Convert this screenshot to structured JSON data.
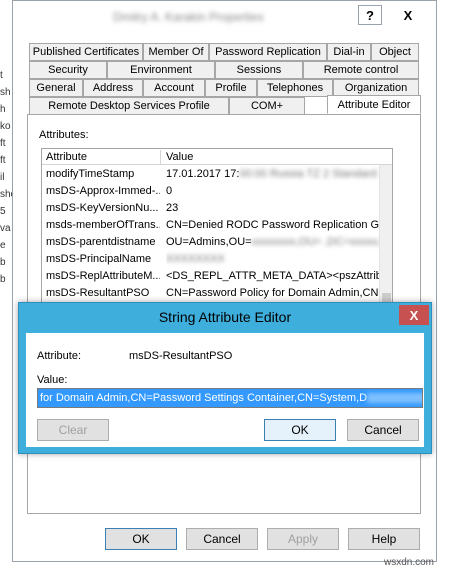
{
  "background_left_text": [
    "t",
    "sh",
    "h",
    "ko",
    "ft",
    "ft",
    "il",
    "she",
    "5",
    "va",
    "e",
    "b",
    "b"
  ],
  "props_window": {
    "title": "Dmitry A. Karakin Properties",
    "help_label": "?",
    "close_label": "X"
  },
  "tabs": {
    "row1": [
      "Published Certificates",
      "Member Of",
      "Password Replication",
      "Dial-in",
      "Object"
    ],
    "row2": [
      "Security",
      "Environment",
      "Sessions",
      "Remote control"
    ],
    "row3": [
      "General",
      "Address",
      "Account",
      "Profile",
      "Telephones",
      "Organization"
    ],
    "row4": [
      "Remote Desktop Services Profile",
      "COM+",
      "Attribute Editor"
    ],
    "active": "Attribute Editor"
  },
  "attributes": {
    "label": "Attributes:",
    "columns": [
      "Attribute",
      "Value"
    ],
    "rows": [
      {
        "name": "modifyTimeStamp",
        "value": "17.01.2017 17:",
        "value_blur": "00:00 Russia TZ 2 Standard"
      },
      {
        "name": "msDS-Approx-Immed-...",
        "value": "0",
        "value_blur": ""
      },
      {
        "name": "msDS-KeyVersionNu...",
        "value": "23",
        "value_blur": ""
      },
      {
        "name": "msds-memberOfTrans...",
        "value": "CN=Denied RODC Password Replication Gro",
        "value_blur": ""
      },
      {
        "name": "msDS-parentdistname",
        "value": "OU=Admins,OU=",
        "value_blur": "xxxxxxxx,OU=   ,DC=xxxxx,DC=xx"
      },
      {
        "name": "msDS-PrincipalName",
        "value": "",
        "value_blur": "XXXXXXXX"
      },
      {
        "name": "msDS-ReplAttributeM...",
        "value": "<DS_REPL_ATTR_META_DATA><pszAttrib",
        "value_blur": ""
      },
      {
        "name": "msDS-ResultantPSO",
        "value": "CN=Password Policy for Domain Admin,CN=P",
        "value_blur": ""
      }
    ]
  },
  "buttons": {
    "ok": "OK",
    "cancel": "Cancel",
    "apply": "Apply",
    "help": "Help"
  },
  "editor": {
    "title": "String Attribute Editor",
    "close_label": "X",
    "attribute_label": "Attribute:",
    "attribute_value": "msDS-ResultantPSO",
    "value_label": "Value:",
    "value_text": "for Domain Admin,CN=Password Settings Container,CN=System,D",
    "clear": "Clear",
    "ok": "OK",
    "cancel": "Cancel"
  },
  "watermark": "wsxdn.com"
}
